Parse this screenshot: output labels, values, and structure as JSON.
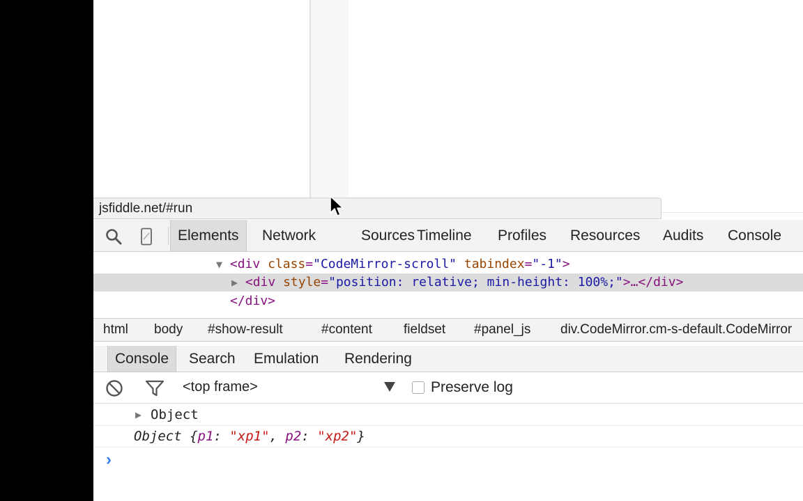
{
  "status_bar": {
    "url": "jsfiddle.net/#run"
  },
  "devtools": {
    "tabs": [
      "Elements",
      "Network",
      "Sources",
      "Timeline",
      "Profiles",
      "Resources",
      "Audits",
      "Console"
    ],
    "elements": {
      "line1": {
        "open": "<div",
        "attr": "class",
        "eq": "=",
        "val": "\"CodeMirror-scroll\"",
        "attr2": "tabindex",
        "val2": "\"-1\"",
        "close": ">"
      },
      "line2": {
        "open": "<div",
        "attr": "style",
        "eq": "=",
        "val": "\"position: relative; min-height: 100%;\"",
        "close": ">…</div>"
      },
      "line3": {
        "text": "</div>"
      }
    },
    "breadcrumbs": [
      "html",
      "body",
      "#show-result",
      "#content",
      "fieldset",
      "#panel_js",
      "div.CodeMirror.cm-s-default.CodeMirror"
    ],
    "drawer_tabs": [
      "Console",
      "Search",
      "Emulation",
      "Rendering"
    ],
    "console": {
      "frame": "<top frame>",
      "preserve_log": "Preserve log",
      "messages": {
        "object_label": "Object",
        "object_summary_prefix": "Object ",
        "brace_open": "{",
        "p1_name": "p1",
        "p1_value": "\"xp1\"",
        "p2_name": "p2",
        "p2_value": "\"xp2\"",
        "brace_close": "}",
        "colon": ": ",
        "comma": ", "
      },
      "prompt": "›"
    }
  }
}
